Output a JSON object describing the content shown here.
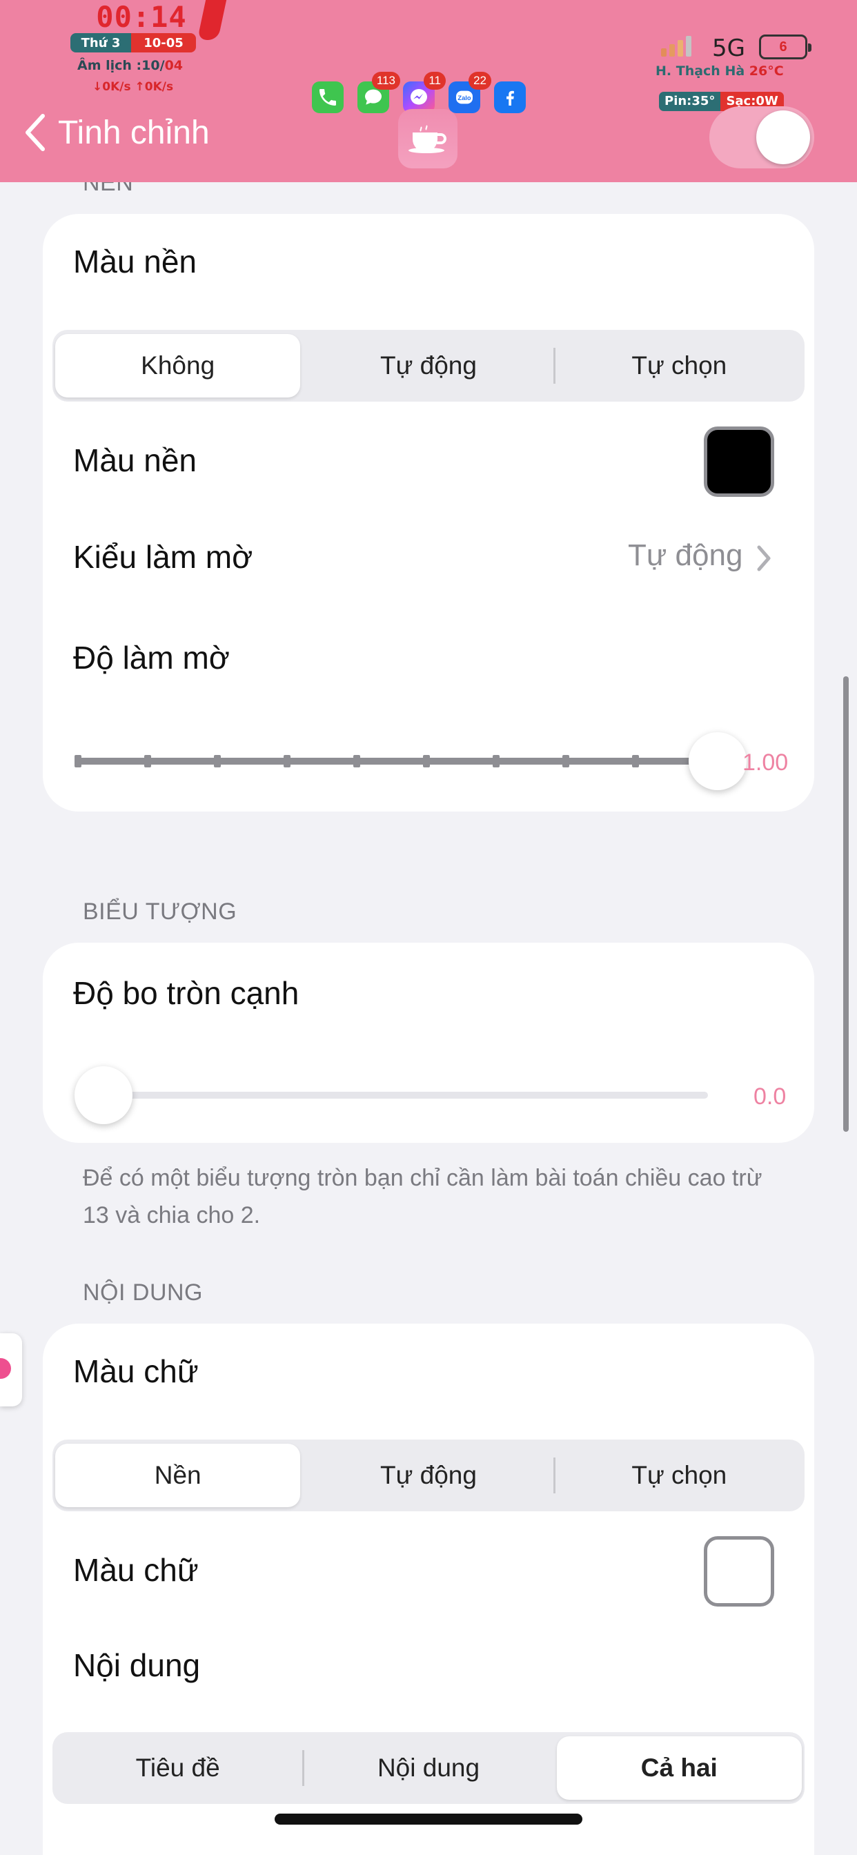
{
  "status_bar": {
    "time": "00:14",
    "weekday": "Thứ 3",
    "date": "10-05",
    "lunar_label": "Âm lịch :",
    "lunar_day": "10",
    "lunar_month": "04",
    "net_down": "↓0K/s",
    "net_up": "↑0K/s",
    "network": "5G",
    "battery": "6",
    "location": "H. Thạch Hà",
    "temperature": "26°C",
    "pin_temp": "Pin:35°",
    "charging": "Sạc:0W",
    "app_badges": {
      "messages": "113",
      "messenger": "11",
      "zalo": "22"
    },
    "zalo_text": "Zalo"
  },
  "nav": {
    "back_label": "Tinh chỉnh",
    "toggle_on": true
  },
  "background_section": {
    "label": "NỀN",
    "bg_color_title": "Màu nền",
    "bg_color_options": [
      "Không",
      "Tự động",
      "Tự chọn"
    ],
    "bg_color_selected": 0,
    "bg_color_row": "Màu nền",
    "bg_swatch_color": "#000000",
    "blur_style_label": "Kiểu làm mờ",
    "blur_style_value": "Tự động",
    "blur_amount_label": "Độ làm mờ",
    "blur_amount_value": "1.00",
    "blur_amount_fraction": 1.0
  },
  "icon_section": {
    "label": "BIỂU TƯỢNG",
    "corner_label": "Độ bo tròn cạnh",
    "corner_value": "0.0",
    "corner_fraction": 0.0,
    "note": "Để có một biểu tượng tròn bạn chỉ cần làm bài toán chiều cao trừ 13 và chia cho 2."
  },
  "content_section": {
    "label": "NỘI DUNG",
    "text_color_title": "Màu chữ",
    "text_color_options": [
      "Nền",
      "Tự động",
      "Tự chọn"
    ],
    "text_color_selected": 0,
    "text_color_row": "Màu chữ",
    "text_swatch_color": "#ffffff",
    "content_title": "Nội dung",
    "content_options": [
      "Tiêu đề",
      "Nội dung",
      "Cả hai"
    ],
    "content_selected": 2
  },
  "colors": {
    "accent_pink": "#ee82a2",
    "background": "#f2f2f6"
  }
}
